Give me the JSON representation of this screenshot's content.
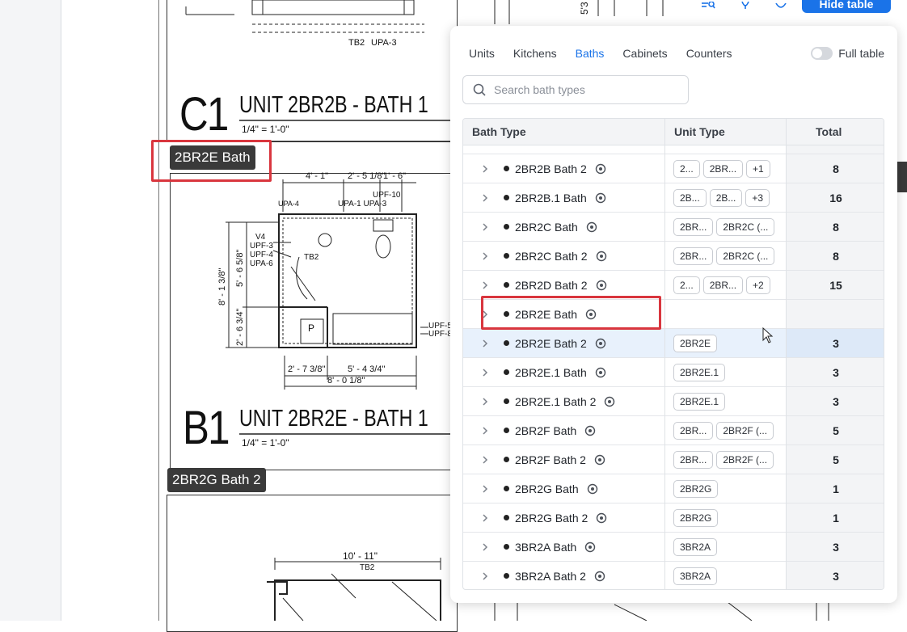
{
  "drawing": {
    "tb2_top": "TB2",
    "upa3_top": "UPA-3",
    "c1_code": "C1",
    "c1_title": "UNIT 2BR2B - BATH 1",
    "c1_scale": "1/4\" = 1'-0\"",
    "tag_2br2e": "2BR2E Bath",
    "dims": {
      "d1": "4' - 1\"",
      "d2": "2' - 5 1/8\"",
      "d3": "1' - 6\"",
      "upf10": "UPF-10",
      "upa4": "UPA-4",
      "upa1_upa3": "UPA-1 UPA-3",
      "v4": "V4",
      "upf3": "UPF-3",
      "upf4": "UPF-4",
      "upa6": "UPA-6",
      "tb2": "TB2",
      "v1": "8' - 1 3/8\"",
      "v2": "5' - 6 5/8\"",
      "v3": "2' - 6 3/4\"",
      "p": "P",
      "b1": "2' - 7 3/8\"",
      "b2": "5' - 4 3/4\"",
      "b3": "8' - 0 1/8\"",
      "upf5": "UPF-5",
      "upf8": "UPF-8"
    },
    "b1_code": "B1",
    "b1_title": "UNIT 2BR2E - BATH 1",
    "b1_scale": "1/4\" = 1'-0\"",
    "tag_2br2g": "2BR2G Bath 2",
    "lower_dim": "10' - 11\"",
    "lower_tb2": "TB2",
    "side_530": "5'3"
  },
  "toolbar": {
    "hide_table": "Hide table",
    "icons": [
      "list-search-icon",
      "lightbulb-icon",
      "gear-icon"
    ]
  },
  "panel": {
    "tabs": [
      "Units",
      "Kitchens",
      "Baths",
      "Cabinets",
      "Counters"
    ],
    "active_tab": "Baths",
    "full_table_label": "Full table",
    "search_placeholder": "Search bath types",
    "columns": [
      "Bath Type",
      "Unit Type",
      "Total"
    ],
    "rows": [
      {
        "name": "2BR2B Bath 2",
        "chips": [
          "2...",
          "2BR...",
          "+1"
        ],
        "total": "8"
      },
      {
        "name": "2BR2B.1 Bath",
        "chips": [
          "2B...",
          "2B...",
          "+3"
        ],
        "total": "16"
      },
      {
        "name": "2BR2C Bath",
        "chips": [
          "2BR...",
          "2BR2C (..."
        ],
        "total": "8"
      },
      {
        "name": "2BR2C Bath 2",
        "chips": [
          "2BR...",
          "2BR2C (..."
        ],
        "total": "8"
      },
      {
        "name": "2BR2D Bath 2",
        "chips": [
          "2...",
          "2BR...",
          "+2"
        ],
        "total": "15"
      },
      {
        "name": "2BR2E Bath",
        "chips": [],
        "total": ""
      },
      {
        "name": "2BR2E Bath 2",
        "chips": [
          "2BR2E"
        ],
        "total": "3"
      },
      {
        "name": "2BR2E.1 Bath",
        "chips": [
          "2BR2E.1"
        ],
        "total": "3"
      },
      {
        "name": "2BR2E.1 Bath 2",
        "chips": [
          "2BR2E.1"
        ],
        "total": "3"
      },
      {
        "name": "2BR2F Bath",
        "chips": [
          "2BR...",
          "2BR2F (..."
        ],
        "total": "5"
      },
      {
        "name": "2BR2F Bath 2",
        "chips": [
          "2BR...",
          "2BR2F (..."
        ],
        "total": "5"
      },
      {
        "name": "2BR2G Bath",
        "chips": [
          "2BR2G"
        ],
        "total": "1"
      },
      {
        "name": "2BR2G Bath 2",
        "chips": [
          "2BR2G"
        ],
        "total": "1"
      },
      {
        "name": "3BR2A Bath",
        "chips": [
          "3BR2A"
        ],
        "total": "3"
      },
      {
        "name": "3BR2A Bath 2",
        "chips": [
          "3BR2A"
        ],
        "total": "3"
      }
    ],
    "selected_row": "2BR2E Bath 2",
    "highlighted_row": "2BR2E Bath"
  },
  "colors": {
    "accent": "#1a73e8",
    "highlight": "#d9363e",
    "tag_bg": "#3a3a3a"
  }
}
